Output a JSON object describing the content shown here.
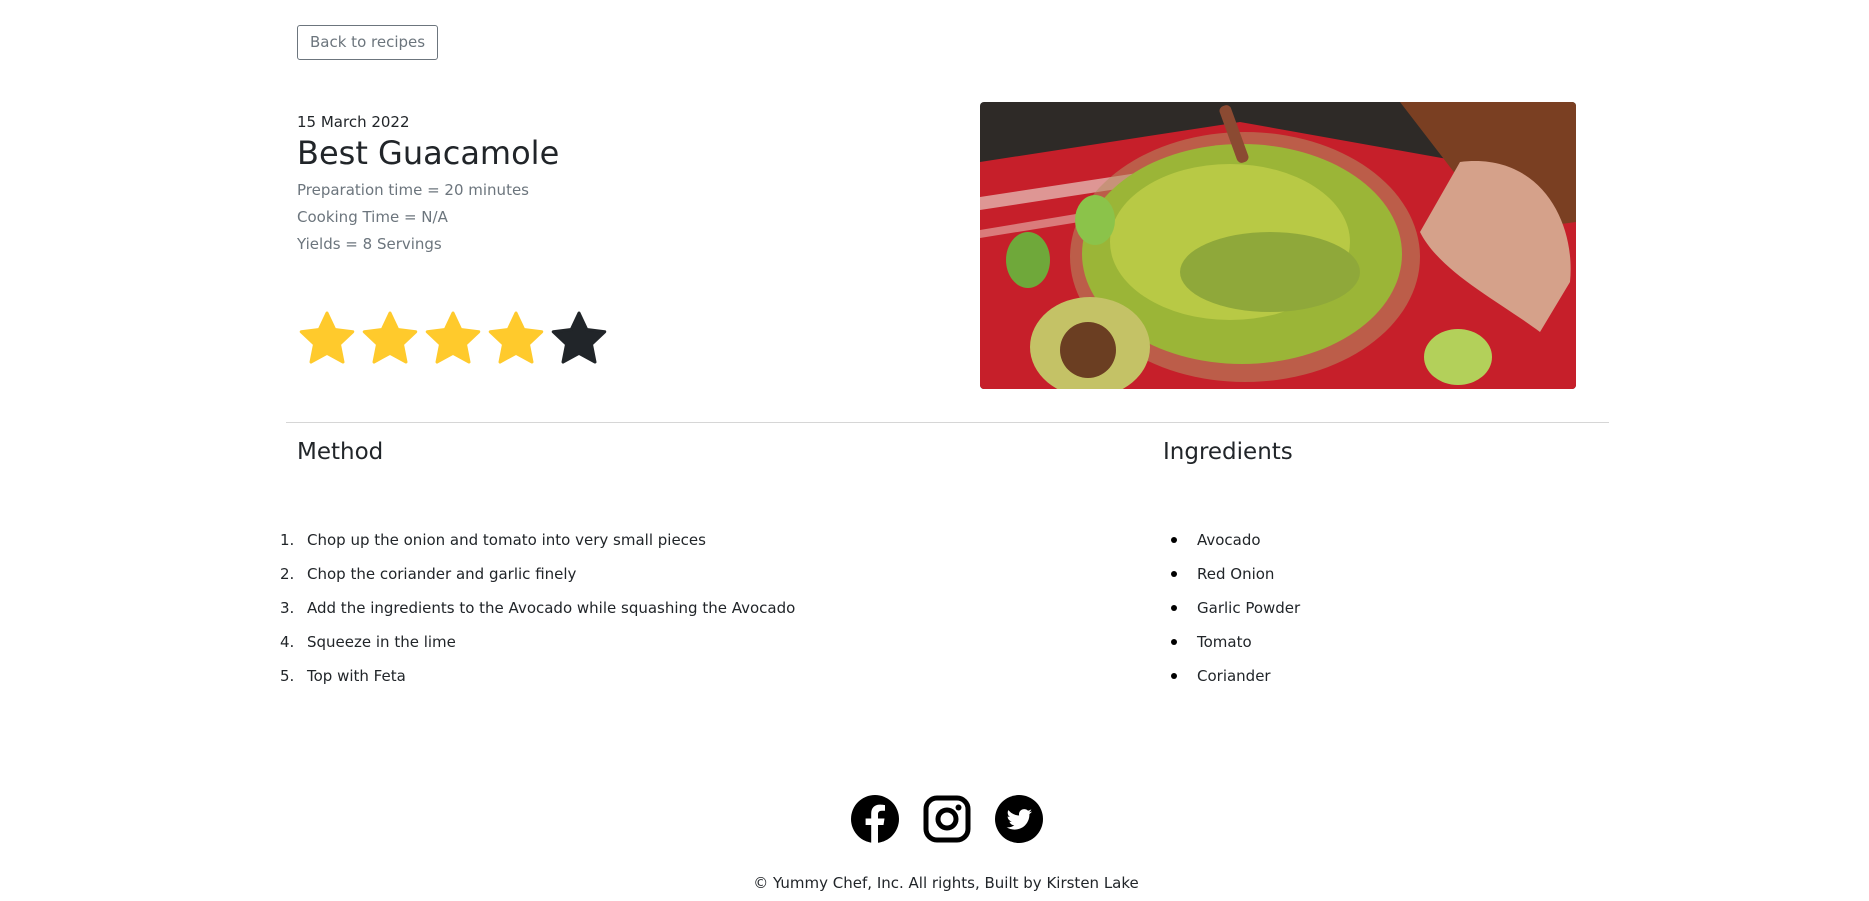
{
  "nav": {
    "back_label": "Back to recipes"
  },
  "recipe": {
    "date": "15 March 2022",
    "title": "Best Guacamole",
    "preparation": "Preparation time = 20 minutes",
    "cooking": "Cooking Time = N/A",
    "yields": "Yields = 8 Servings",
    "rating": {
      "value": 4,
      "max": 5,
      "filled_color": "#ffca2c",
      "empty_color": "#212529"
    }
  },
  "method": {
    "title": "Method",
    "steps": [
      {
        "num": "1.",
        "text": "Chop up the onion and tomato into very small pieces"
      },
      {
        "num": "2.",
        "text": "Chop the coriander and garlic finely"
      },
      {
        "num": "3.",
        "text": "Add the ingredients to the Avocado while squashing the Avocado"
      },
      {
        "num": "4.",
        "text": "Squeeze in the lime"
      },
      {
        "num": "5.",
        "text": "Top with Feta"
      }
    ]
  },
  "ingredients": {
    "title": "Ingredients",
    "items": [
      "Avocado",
      "Red Onion",
      "Garlic Powder",
      "Tomato",
      "Coriander"
    ]
  },
  "footer": {
    "social": [
      "facebook-icon",
      "instagram-icon",
      "twitter-icon"
    ],
    "copyright": "© Yummy Chef, Inc. All rights, Built by Kirsten Lake"
  }
}
